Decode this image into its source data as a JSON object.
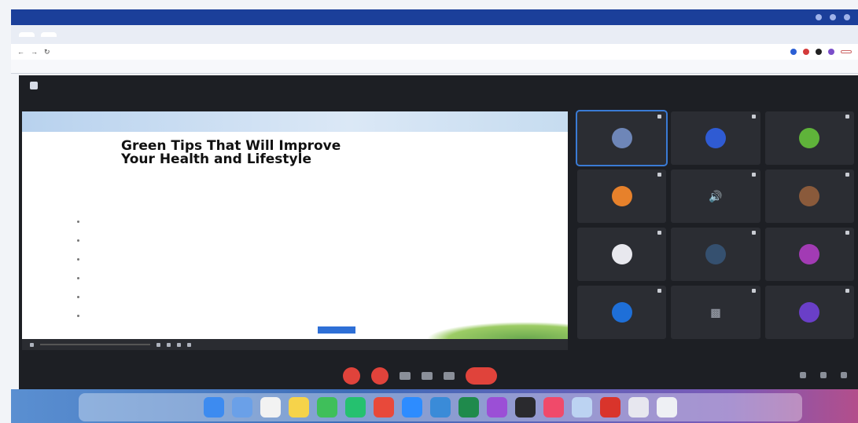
{
  "slide": {
    "title_line1": "Green Tips That Will Improve",
    "title_line2": "Your Health and Lifestyle"
  },
  "colors": {
    "os_bar": "#1b3f9a",
    "zoom_bg": "#1d1f24",
    "tile_bg": "#2b2d33",
    "leave_red": "#e0433b",
    "active_blue": "#3a7bd5"
  },
  "participants": [
    {
      "avatar_color": "#6e86b8",
      "icon": "person-avatar",
      "active": true
    },
    {
      "avatar_color": "#2f5bd3",
      "icon": "person-avatar"
    },
    {
      "avatar_color": "#5fb33a",
      "icon": "person-avatar"
    },
    {
      "avatar_color": "#e7812b",
      "icon": "person-avatar"
    },
    {
      "avatar_color": "#2b2d33",
      "icon": "speaker-icon"
    },
    {
      "avatar_color": "#8a5a3b",
      "icon": "photo-avatar"
    },
    {
      "avatar_color": "#e8e8ee",
      "icon": "person-avatar"
    },
    {
      "avatar_color": "#35506f",
      "icon": "person-avatar"
    },
    {
      "avatar_color": "#a23bb4",
      "icon": "person-avatar"
    },
    {
      "avatar_color": "#1e6fd8",
      "icon": "person-avatar"
    },
    {
      "avatar_color": "#3a3c42",
      "icon": "video-off"
    },
    {
      "avatar_color": "#6a3fc8",
      "icon": "person-avatar"
    }
  ],
  "dock_apps": [
    {
      "icon": "finder-icon",
      "color": "#3d8bf0"
    },
    {
      "icon": "photos-icon",
      "color": "#6aa0e8"
    },
    {
      "icon": "calendar-icon",
      "color": "#f2f2f2"
    },
    {
      "icon": "notes-icon",
      "color": "#f6d34a"
    },
    {
      "icon": "facetime-icon",
      "color": "#3fbf5a"
    },
    {
      "icon": "whatsapp-icon",
      "color": "#25c16f"
    },
    {
      "icon": "chrome-icon",
      "color": "#e8493a"
    },
    {
      "icon": "zoom-icon",
      "color": "#2d8cff"
    },
    {
      "icon": "maps-icon",
      "color": "#3a8bd8"
    },
    {
      "icon": "excel-icon",
      "color": "#1f8a4c"
    },
    {
      "icon": "podcasts-icon",
      "color": "#9b4fd6"
    },
    {
      "icon": "screen-icon",
      "color": "#2a2a2e"
    },
    {
      "icon": "music-icon",
      "color": "#f04a6a"
    },
    {
      "icon": "preview-icon",
      "color": "#bcd3f2"
    },
    {
      "icon": "photo-booth-icon",
      "color": "#d9342b"
    },
    {
      "icon": "keynote-icon",
      "color": "#e7e7ef"
    },
    {
      "icon": "trash-icon",
      "color": "#eef0f4"
    }
  ]
}
